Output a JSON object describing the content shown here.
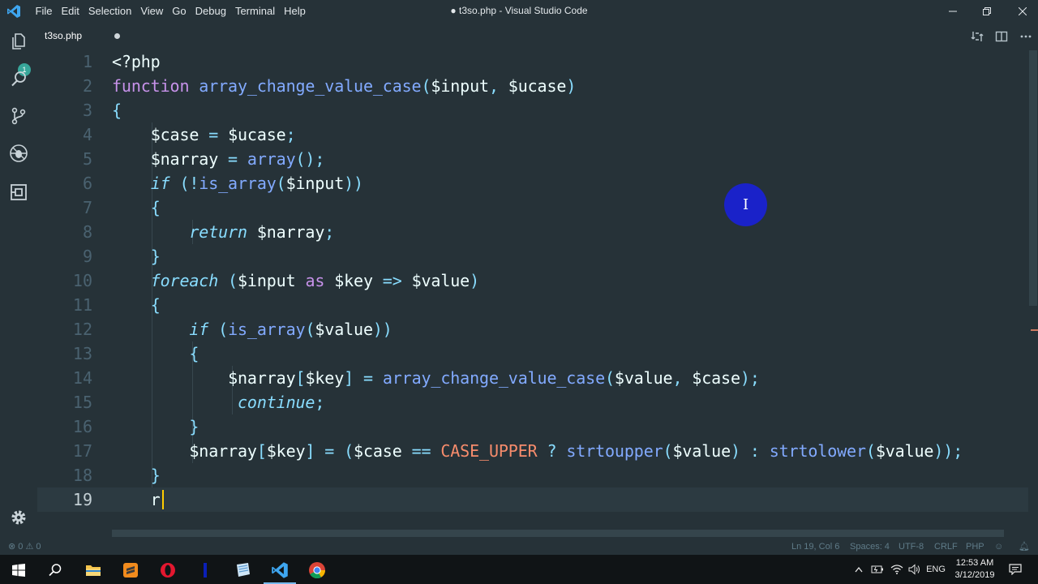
{
  "window": {
    "title": "● t3so.php - Visual Studio Code",
    "menu": [
      "File",
      "Edit",
      "Selection",
      "View",
      "Go",
      "Debug",
      "Terminal",
      "Help"
    ]
  },
  "activity": {
    "explorer_badge": "1"
  },
  "tab": {
    "label": "t3so.php"
  },
  "editor": {
    "current_line": 19,
    "lines": [
      {
        "n": "1"
      },
      {
        "n": "2"
      },
      {
        "n": "3"
      },
      {
        "n": "4"
      },
      {
        "n": "5"
      },
      {
        "n": "6"
      },
      {
        "n": "7"
      },
      {
        "n": "8"
      },
      {
        "n": "9"
      },
      {
        "n": "10"
      },
      {
        "n": "11"
      },
      {
        "n": "12"
      },
      {
        "n": "13"
      },
      {
        "n": "14"
      },
      {
        "n": "15"
      },
      {
        "n": "16"
      },
      {
        "n": "17"
      },
      {
        "n": "18"
      },
      {
        "n": "19"
      }
    ],
    "code": [
      [
        [
          "t-plain",
          "<?php"
        ]
      ],
      [
        [
          "t-kw",
          "function "
        ],
        [
          "t-fn",
          "array_change_value_case"
        ],
        [
          "t-pun",
          "("
        ],
        [
          "t-var",
          "$input"
        ],
        [
          "t-pun",
          ", "
        ],
        [
          "t-var",
          "$ucase"
        ],
        [
          "t-pun",
          ")"
        ]
      ],
      [
        [
          "t-pun",
          "{"
        ]
      ],
      [
        [
          "t-plain",
          "    "
        ],
        [
          "t-var",
          "$case"
        ],
        [
          "t-pun",
          " = "
        ],
        [
          "t-var",
          "$ucase"
        ],
        [
          "t-pun",
          ";"
        ]
      ],
      [
        [
          "t-plain",
          "    "
        ],
        [
          "t-var",
          "$narray"
        ],
        [
          "t-pun",
          " = "
        ],
        [
          "t-fn",
          "array"
        ],
        [
          "t-pun",
          "();"
        ]
      ],
      [
        [
          "t-plain",
          "    "
        ],
        [
          "t-it",
          "if"
        ],
        [
          "t-pun",
          " (!"
        ],
        [
          "t-fn",
          "is_array"
        ],
        [
          "t-pun",
          "("
        ],
        [
          "t-var",
          "$input"
        ],
        [
          "t-pun",
          "))"
        ]
      ],
      [
        [
          "t-plain",
          "    "
        ],
        [
          "t-pun",
          "{"
        ]
      ],
      [
        [
          "t-plain",
          "        "
        ],
        [
          "t-it",
          "return"
        ],
        [
          "t-plain",
          " "
        ],
        [
          "t-var",
          "$narray"
        ],
        [
          "t-pun",
          ";"
        ]
      ],
      [
        [
          "t-plain",
          "    "
        ],
        [
          "t-pun",
          "}"
        ]
      ],
      [
        [
          "t-plain",
          "    "
        ],
        [
          "t-it",
          "foreach"
        ],
        [
          "t-pun",
          " ("
        ],
        [
          "t-var",
          "$input"
        ],
        [
          "t-plain",
          " "
        ],
        [
          "t-kw",
          "as"
        ],
        [
          "t-plain",
          " "
        ],
        [
          "t-var",
          "$key"
        ],
        [
          "t-pun",
          " => "
        ],
        [
          "t-var",
          "$value"
        ],
        [
          "t-pun",
          ")"
        ]
      ],
      [
        [
          "t-plain",
          "    "
        ],
        [
          "t-pun",
          "{"
        ]
      ],
      [
        [
          "t-plain",
          "        "
        ],
        [
          "t-it",
          "if"
        ],
        [
          "t-pun",
          " ("
        ],
        [
          "t-fn",
          "is_array"
        ],
        [
          "t-pun",
          "("
        ],
        [
          "t-var",
          "$value"
        ],
        [
          "t-pun",
          "))"
        ]
      ],
      [
        [
          "t-plain",
          "        "
        ],
        [
          "t-pun",
          "{"
        ]
      ],
      [
        [
          "t-plain",
          "            "
        ],
        [
          "t-var",
          "$narray"
        ],
        [
          "t-pun",
          "["
        ],
        [
          "t-var",
          "$key"
        ],
        [
          "t-pun",
          "] = "
        ],
        [
          "t-fn",
          "array_change_value_case"
        ],
        [
          "t-pun",
          "("
        ],
        [
          "t-var",
          "$value"
        ],
        [
          "t-pun",
          ", "
        ],
        [
          "t-var",
          "$case"
        ],
        [
          "t-pun",
          ");"
        ]
      ],
      [
        [
          "t-plain",
          "             "
        ],
        [
          "t-it",
          "continue"
        ],
        [
          "t-pun",
          ";"
        ]
      ],
      [
        [
          "t-plain",
          "        "
        ],
        [
          "t-pun",
          "}"
        ]
      ],
      [
        [
          "t-plain",
          "        "
        ],
        [
          "t-var",
          "$narray"
        ],
        [
          "t-pun",
          "["
        ],
        [
          "t-var",
          "$key"
        ],
        [
          "t-pun",
          "] = ("
        ],
        [
          "t-var",
          "$case"
        ],
        [
          "t-pun",
          " == "
        ],
        [
          "t-const",
          "CASE_UPPER"
        ],
        [
          "t-pun",
          " ? "
        ],
        [
          "t-fn",
          "strtoupper"
        ],
        [
          "t-pun",
          "("
        ],
        [
          "t-var",
          "$value"
        ],
        [
          "t-pun",
          ") : "
        ],
        [
          "t-fn",
          "strtolower"
        ],
        [
          "t-pun",
          "("
        ],
        [
          "t-var",
          "$value"
        ],
        [
          "t-pun",
          "));"
        ]
      ],
      [
        [
          "t-plain",
          "    "
        ],
        [
          "t-pun",
          "}"
        ]
      ],
      [
        [
          "t-plain",
          "    r"
        ]
      ]
    ]
  },
  "statusbar": {
    "problems": "0",
    "warnings": "0",
    "position": "Ln 19, Col 6",
    "spaces": "Spaces: 4",
    "encoding": "UTF-8",
    "eol": "CRLF",
    "language": "PHP"
  },
  "taskbar": {
    "language": "ENG",
    "time": "12:53 AM",
    "date": "3/12/2019"
  },
  "colors": {
    "editor_bg": "#263238",
    "keyword": "#c792ea",
    "function": "#82aaff",
    "punctuation": "#89ddff",
    "constant": "#f78c6c",
    "cursor": "#ffcc00",
    "click_indicator": "#1a22c9"
  }
}
